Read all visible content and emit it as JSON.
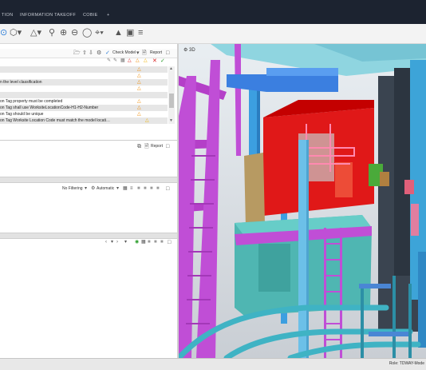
{
  "tabs": [
    "TION",
    "INFORMATION TAKEOFF",
    "COBIE",
    "+"
  ],
  "toolbar_icons": [
    "box-icon",
    "cube-dropdown-icon",
    "zoom-extents-icon",
    "zoom-in-icon",
    "zoom-out-icon",
    "zoom-window-icon",
    "crosshair-dropdown-icon",
    "section-icon",
    "pin-icon",
    "layers-icon"
  ],
  "check_panel": {
    "check_model_label": "Check Model",
    "report_label": "Report",
    "rows": [
      {
        "text": "",
        "status": "warn"
      },
      {
        "text": "",
        "status": "warn"
      },
      {
        "text": "n the level classification",
        "status": "warn"
      },
      {
        "text": "",
        "status": "warn"
      },
      {
        "text": "",
        "status": "none"
      },
      {
        "text": "on Tag property must be completed",
        "status": "warn"
      },
      {
        "text": "on Tag shall use WorksiteLocationCode-H1-H2-Number",
        "status": "warn"
      },
      {
        "text": "on Tag should be unique",
        "status": "warn"
      },
      {
        "text": "on Tag Worksite Location Code must match the model locati…",
        "status": "warn"
      }
    ]
  },
  "report_label_2": "Report",
  "filter_panel": {
    "filter_label": "No Filtering",
    "mode_label": "Automatic"
  },
  "view_label": "3D",
  "status": {
    "role": "Role: TDWAY-Mode"
  },
  "colors": {
    "topbar": "#1c2330",
    "accent": "#2f7fd8",
    "warning": "#f08a00",
    "error": "#d82020",
    "ok": "#2a9d2a"
  }
}
